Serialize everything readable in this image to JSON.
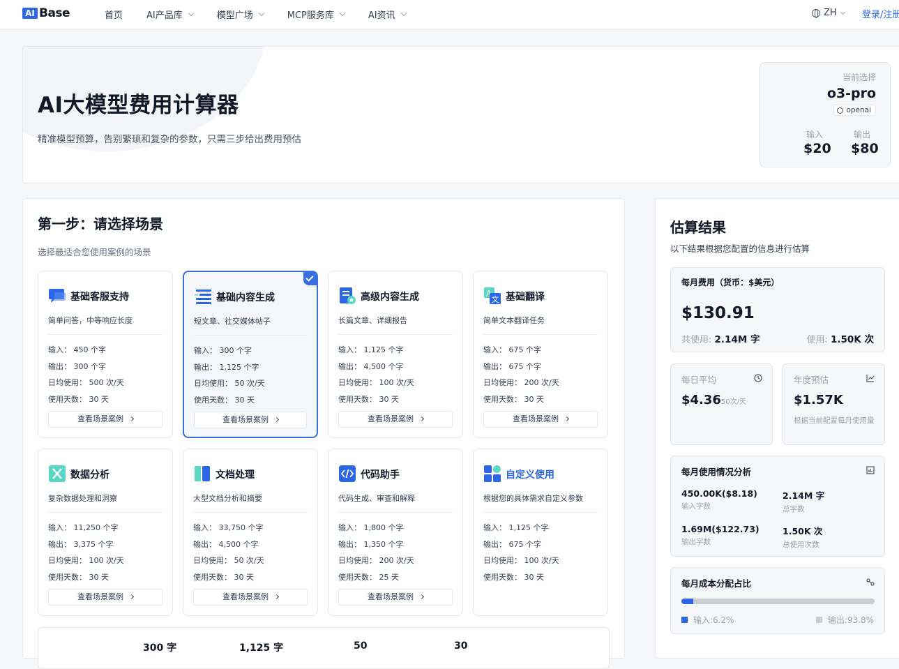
{
  "header": {
    "logo_mark": "AI",
    "logo_text": "Base",
    "nav": [
      "首页",
      "AI产品库",
      "模型广场",
      "MCP服务库",
      "AI资讯"
    ],
    "language": "ZH",
    "login": "登录/注册"
  },
  "hero": {
    "title": "AI大模型费用计算器",
    "subtitle": "精准模型预算，告别繁琐和复杂的参数，只需三步给出费用预估",
    "current_label": "当前选择",
    "model": "o3-pro",
    "provider": "openai",
    "input_label": "输入",
    "input_price": "$20",
    "output_label": "输出",
    "output_price": "$80"
  },
  "step1": {
    "title": "第一步：请选择场景",
    "description": "选择最适合您使用案例的场景",
    "btn_label": "查看场景案例",
    "stat_labels": {
      "input": "输入：",
      "output": "输出：",
      "daily": "日均使用：",
      "days": "使用天数："
    },
    "scenarios": [
      {
        "title": "基础客服支持",
        "desc": "简单问答，中等响应长度",
        "input": "450 个字",
        "output": "300 个字",
        "daily": "500 次/天",
        "days": "30 天",
        "icon": "chat-icon",
        "color": "#2b66e7"
      },
      {
        "title": "基础内容生成",
        "desc": "短文章、社交媒体帖子",
        "input": "300 个字",
        "output": "1,125 个字",
        "daily": "50 次/天",
        "days": "30 天",
        "icon": "lines-icon",
        "color": "#2b66e7",
        "selected": true
      },
      {
        "title": "高级内容生成",
        "desc": "长篇文章、详细报告",
        "input": "1,125 个字",
        "output": "4,500 个字",
        "daily": "100 次/天",
        "days": "30 天",
        "icon": "document-star-icon",
        "color": "#2b66e7"
      },
      {
        "title": "基础翻译",
        "desc": "简单文本翻译任务",
        "input": "675 个字",
        "output": "675 个字",
        "daily": "200 次/天",
        "days": "30 天",
        "icon": "translate-icon",
        "color": "#2b66e7"
      },
      {
        "title": "数据分析",
        "desc": "复杂数据处理和洞察",
        "input": "11,250 个字",
        "output": "3,375 个字",
        "daily": "100 次/天",
        "days": "30 天",
        "icon": "spreadsheet-icon",
        "color": "#5ad6c2"
      },
      {
        "title": "文档处理",
        "desc": "大型文档分析和摘要",
        "input": "33,750 个字",
        "output": "4,500 个字",
        "daily": "50 次/天",
        "days": "30 天",
        "icon": "book-icon",
        "color": "#2b66e7"
      },
      {
        "title": "代码助手",
        "desc": "代码生成、审查和解释",
        "input": "1,800 个字",
        "output": "1,350 个字",
        "daily": "200 次/天",
        "days": "25 天",
        "icon": "code-icon",
        "color": "#2b66e7"
      },
      {
        "title": "自定义使用",
        "desc": "根据您的具体需求自定义参数",
        "input": "1,125 个字",
        "output": "675 个字",
        "daily": "100 次/天",
        "days": "30 天",
        "icon": "grid-icon",
        "color": "#2b66e7",
        "custom": true
      }
    ],
    "summary": [
      "300 字",
      "1,125 字",
      "50",
      "30"
    ]
  },
  "result": {
    "title": "估算结果",
    "description": "以下结果根据您配置的信息进行估算",
    "monthly_label": "每月费用（货币：$美元）",
    "monthly_cost": "$130.91",
    "total_label": "共使用:",
    "total_value": "2.14M 字",
    "usage_label": "使用:",
    "usage_value": "1.50K 次",
    "daily_label": "每日平均",
    "daily_value": "$4.36",
    "daily_unit": "50次/天",
    "yearly_label": "年度预估",
    "yearly_value": "$1.57K",
    "yearly_note": "根据当前配置每月使用量",
    "analysis_title": "每月使用情况分析",
    "analysis": [
      {
        "value": "450.00K($8.18)",
        "caption": "输入字数"
      },
      {
        "value": "2.14M 字",
        "caption": "总字数"
      },
      {
        "value": "1.69M($122.73)",
        "caption": "输出字数"
      },
      {
        "value": "1.50K 次",
        "caption": "总使用次数"
      }
    ],
    "ratio_title": "每月成本分配占比",
    "input_share": 6.2,
    "input_share_label": "输入:6.2%",
    "output_share_label": "输出:93.8%",
    "colors": {
      "input": "#2b66e7",
      "output": "#c9ccd3"
    }
  }
}
